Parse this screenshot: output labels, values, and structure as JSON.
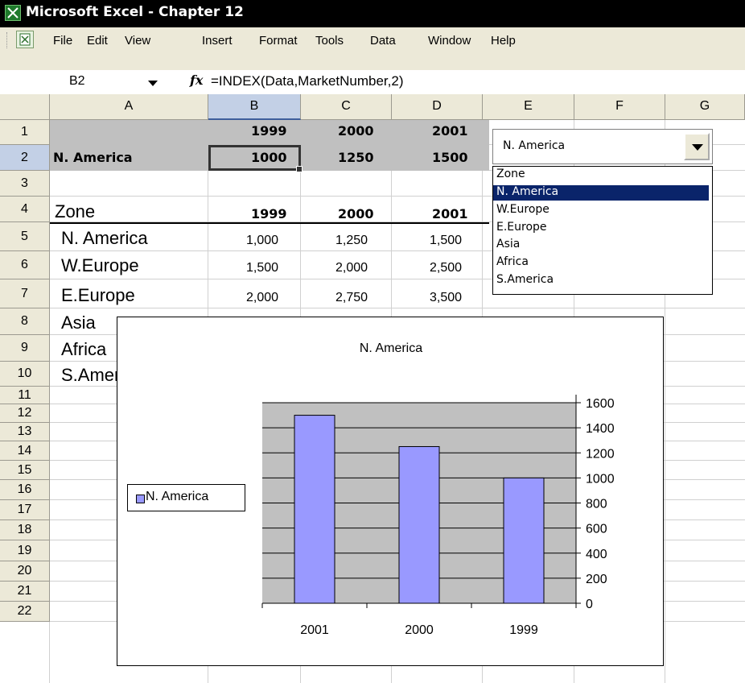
{
  "window": {
    "title": "Microsoft Excel - Chapter 12"
  },
  "menu": [
    "File",
    "Edit",
    "View",
    "Insert",
    "Format",
    "Tools",
    "Data",
    "Window",
    "Help"
  ],
  "formula_bar": {
    "name_box": "B2",
    "fx": "fx",
    "formula": "=INDEX(Data,MarketNumber,2)"
  },
  "columns": [
    "A",
    "B",
    "C",
    "D",
    "E",
    "F",
    "G"
  ],
  "rows": [
    "1",
    "2",
    "3",
    "4",
    "5",
    "6",
    "7",
    "8",
    "9",
    "10",
    "11",
    "12",
    "13",
    "14",
    "15",
    "16",
    "17",
    "18",
    "19",
    "20",
    "21",
    "22"
  ],
  "header_block": {
    "years": [
      "1999",
      "2000",
      "2001"
    ],
    "selected_zone": "N. America",
    "values": [
      "1000",
      "1250",
      "1500"
    ]
  },
  "table": {
    "header": "Zone",
    "years": [
      "1999",
      "2000",
      "2001"
    ],
    "rows": [
      {
        "zone": "N. America",
        "values": [
          "1,000",
          "1,250",
          "1,500"
        ]
      },
      {
        "zone": "W.Europe",
        "values": [
          "1,500",
          "2,000",
          "2,500"
        ]
      },
      {
        "zone": "E.Europe",
        "values": [
          "2,000",
          "2,750",
          "3,500"
        ]
      },
      {
        "zone": "Asia"
      },
      {
        "zone": "Africa"
      },
      {
        "zone": "S.America"
      }
    ]
  },
  "dropdown": {
    "selected": "N. America",
    "items": [
      "Zone",
      "N. America",
      "W.Europe",
      "E.Europe",
      "Asia",
      "Africa",
      "S.America"
    ],
    "highlighted_index": 1
  },
  "chart_data": {
    "type": "bar",
    "title": "N. America",
    "categories": [
      "2001",
      "2000",
      "1999"
    ],
    "series": [
      {
        "name": "N. America",
        "values": [
          1500,
          1250,
          1000
        ],
        "color": "#9999ff"
      }
    ],
    "ylim": [
      0,
      1600
    ],
    "yticks": [
      "0",
      "200",
      "400",
      "600",
      "800",
      "1000",
      "1200",
      "1400",
      "1600"
    ],
    "y_axis_side": "right",
    "plot_background": "#c0c0c0",
    "grid": true,
    "legend": "left"
  }
}
